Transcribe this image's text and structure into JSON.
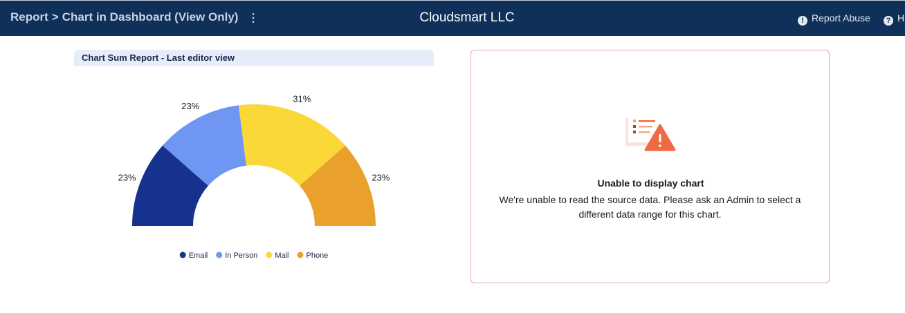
{
  "header": {
    "breadcrumb_report": "Report",
    "breadcrumb_sep": ">",
    "breadcrumb_page": "Chart in Dashboard (View Only)",
    "menu_icon": "kebab-icon",
    "org_name": "Cloudsmart LLC",
    "report_abuse_label": "Report Abuse",
    "help_label": "H",
    "bg_color": "#0e3059"
  },
  "left_widget": {
    "title": "Chart Sum Report - Last editor view"
  },
  "chart_data": {
    "type": "pie",
    "variant": "half-donut",
    "title": "Chart Sum Report - Last editor view",
    "categories": [
      "Email",
      "In Person",
      "Mail",
      "Phone"
    ],
    "values": [
      23,
      23,
      31,
      23
    ],
    "labels": [
      "23%",
      "23%",
      "31%",
      "23%"
    ],
    "colors": [
      "#17318f",
      "#6e96f2",
      "#f9d838",
      "#eaa12c"
    ],
    "legend_position": "bottom"
  },
  "right_widget": {
    "icon": "chart-warning-icon",
    "error_title": "Unable to display chart",
    "error_message": "We're unable to read the source data. Please ask an Admin to select a different data range for this chart.",
    "border_color": "#e0a5ad",
    "accent_color": "#ee6a45"
  }
}
